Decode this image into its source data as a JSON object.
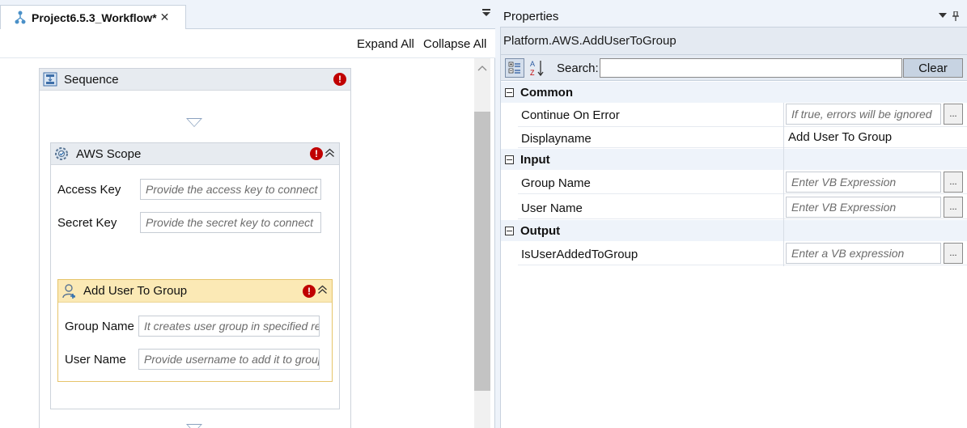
{
  "document_tab": {
    "title": "Project6.5.3_Workflow*",
    "close_glyph": "✕"
  },
  "designer": {
    "expand_all": "Expand All",
    "collapse_all": "Collapse All",
    "sequence": {
      "title": "Sequence"
    },
    "aws_scope": {
      "title": "AWS Scope",
      "fields": [
        {
          "label": "Access Key",
          "placeholder": "Provide the access key to connect"
        },
        {
          "label": "Secret Key",
          "placeholder": "Provide the secret key to connect"
        }
      ]
    },
    "add_user_to_group": {
      "title": "Add User To Group",
      "fields": [
        {
          "label": "Group Name",
          "placeholder": "It creates user group in specified region"
        },
        {
          "label": "User Name",
          "placeholder": "Provide username to add it to group"
        }
      ]
    },
    "error_glyph": "!"
  },
  "properties": {
    "title": "Properties",
    "type_name": "Platform.AWS.AddUserToGroup",
    "search_label": "Search:",
    "search_value": "",
    "clear_label": "Clear",
    "ellipsis": "...",
    "categories": [
      {
        "label": "Common",
        "rows": [
          {
            "name": "Continue On Error",
            "placeholder": "If true, errors will be ignored"
          },
          {
            "name": "Displayname",
            "value": "Add User To Group"
          }
        ]
      },
      {
        "label": "Input",
        "rows": [
          {
            "name": "Group Name",
            "placeholder": "Enter VB Expression"
          },
          {
            "name": "User Name",
            "placeholder": "Enter VB Expression"
          }
        ]
      },
      {
        "label": "Output",
        "rows": [
          {
            "name": "IsUserAddedToGroup",
            "placeholder": "Enter a VB expression"
          }
        ]
      }
    ]
  },
  "colors": {
    "accent_error": "#c00000",
    "selected_activity_header": "#fbe9b5",
    "panel_bg": "#eef3fa"
  },
  "icons": [
    "workflow-icon",
    "sequence-icon",
    "gear-icon",
    "user-add-icon",
    "chevron-up-icon",
    "categorized-icon",
    "alphabetical-sort-icon",
    "pin-icon",
    "dropdown-icon"
  ]
}
